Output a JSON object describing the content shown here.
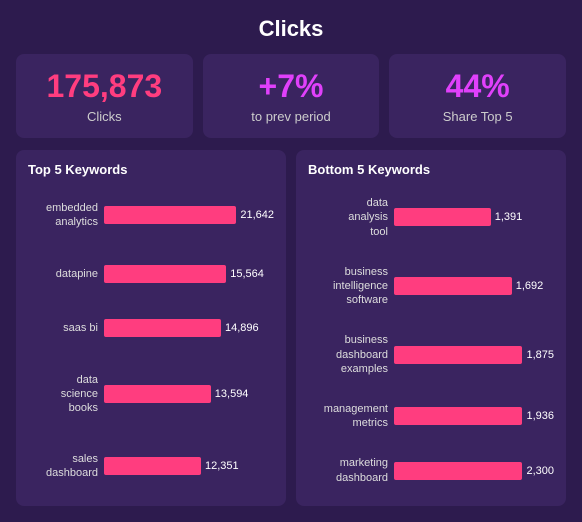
{
  "title": "Clicks",
  "stats": [
    {
      "id": "clicks",
      "value": "175,873",
      "label": "Clicks",
      "color": "pink"
    },
    {
      "id": "prev-period",
      "value": "+7%",
      "label": "to prev period",
      "color": "magenta"
    },
    {
      "id": "share-top5",
      "value": "44%",
      "label": "Share Top 5",
      "color": "magenta"
    }
  ],
  "top5": {
    "title": "Top 5 Keywords",
    "max": 21642,
    "items": [
      {
        "label": "embedded\nanalytics",
        "value": 21642,
        "display": "21,642"
      },
      {
        "label": "datapine",
        "value": 15564,
        "display": "15,564"
      },
      {
        "label": "saas bi",
        "value": 14896,
        "display": "14,896"
      },
      {
        "label": "data\nscience\nbooks",
        "value": 13594,
        "display": "13,594"
      },
      {
        "label": "sales\ndashboard",
        "value": 12351,
        "display": "12,351"
      }
    ]
  },
  "bottom5": {
    "title": "Bottom 5 Keywords",
    "max": 2300,
    "items": [
      {
        "label": "data\nanalysis\ntool",
        "value": 1391,
        "display": "1,391"
      },
      {
        "label": "business\nintelligence\nsoftware",
        "value": 1692,
        "display": "1,692"
      },
      {
        "label": "business\ndashboard\nexamples",
        "value": 1875,
        "display": "1,875"
      },
      {
        "label": "management\nmetrics",
        "value": 1936,
        "display": "1,936"
      },
      {
        "label": "marketing\ndashboard",
        "value": 2300,
        "display": "2,300"
      }
    ]
  }
}
